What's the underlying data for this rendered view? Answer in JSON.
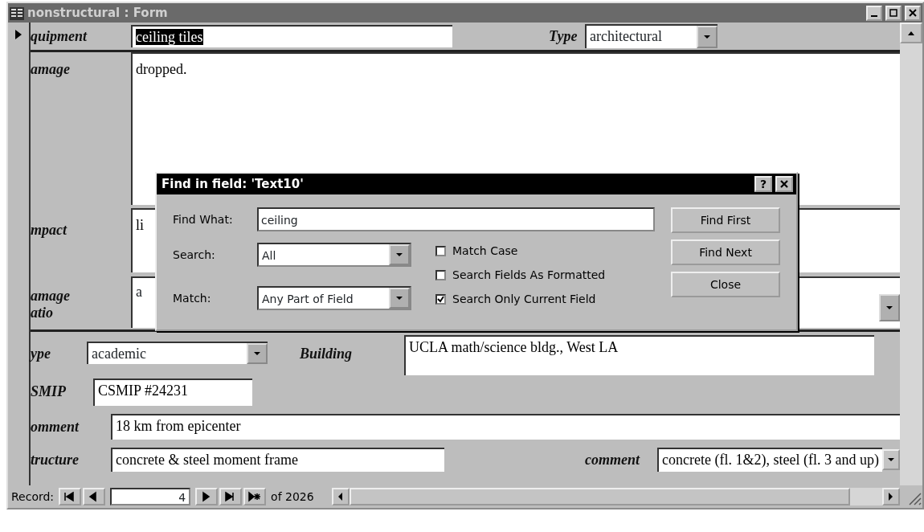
{
  "window": {
    "title": "nonstructural : Form"
  },
  "form": {
    "equipment": {
      "label": "quipment",
      "value": "ceiling tiles",
      "value_selected": true
    },
    "type": {
      "label": "Type",
      "value": "architectural"
    },
    "damage": {
      "label": "amage",
      "value": "dropped."
    },
    "impact": {
      "label": "mpact",
      "value": "li"
    },
    "damage_ratio": {
      "label_lines": [
        "amage",
        "atio"
      ],
      "value": "a"
    },
    "building_type": {
      "label": "ype",
      "value": "academic"
    },
    "building": {
      "label": "Building",
      "value": "UCLA math/science bldg., West LA"
    },
    "csmip": {
      "label": "SMIP",
      "value": "CSMIP #24231"
    },
    "comment": {
      "label": "omment",
      "value": "18 km from epicenter"
    },
    "structure": {
      "label": "tructure",
      "value": "concrete & steel moment frame"
    },
    "structure_comment": {
      "label": "comment",
      "value": "concrete (fl. 1&2), steel (fl. 3 and up)"
    }
  },
  "record_navigator": {
    "label": "Record:",
    "current": "4",
    "total": "of 2026"
  },
  "find_dialog": {
    "title": "Find in field: 'Text10'",
    "help": "?",
    "find_what": {
      "label": "Find What:",
      "value": "ceiling"
    },
    "search": {
      "label": "Search:",
      "value": "All"
    },
    "match": {
      "label": "Match:",
      "value": "Any Part of Field"
    },
    "options": [
      {
        "label": "Match Case",
        "checked": false
      },
      {
        "label": "Search Fields As Formatted",
        "checked": false
      },
      {
        "label": "Search Only Current Field",
        "checked": true
      }
    ],
    "buttons": [
      "Find First",
      "Find Next",
      "Close"
    ]
  }
}
